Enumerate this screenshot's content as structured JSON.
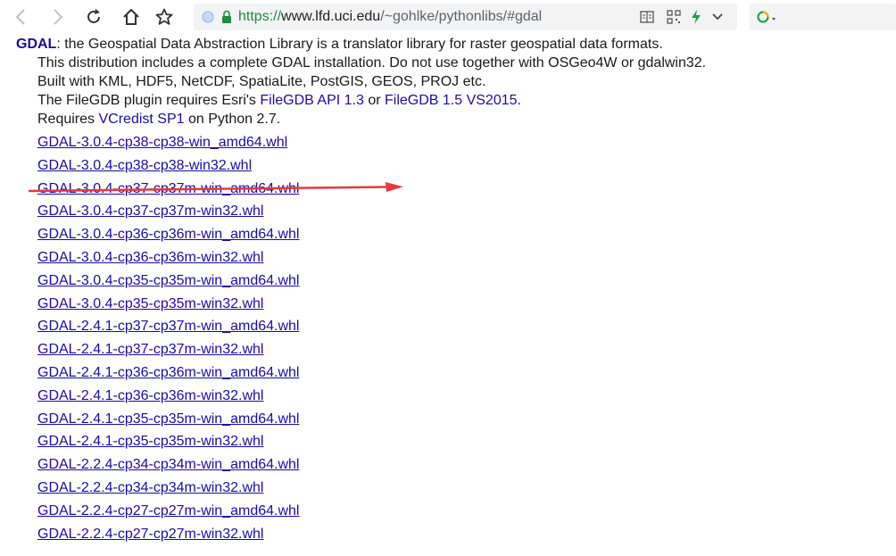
{
  "browser": {
    "url_scheme": "https://",
    "url_host": "www.lfd.uci.edu",
    "url_path": "/~gohlke/pythonlibs/#gdal",
    "accent_secure": "#1e8e3e",
    "icons": [
      "back-icon",
      "forward-icon",
      "reload-icon",
      "home-icon",
      "star-icon",
      "globe-icon",
      "lock-icon",
      "reader-mode-icon",
      "qr-code-icon",
      "bolt-icon",
      "chevron-down-icon",
      "search-engine-icon"
    ]
  },
  "page": {
    "title_name": "GDAL",
    "title_rest": ": the Geospatial Data Abstraction Library is a translator library for raster geospatial data formats.",
    "line2": "This distribution includes a complete GDAL installation. Do not use together with OSGeo4W or gdalwin32.",
    "line3": "Built with KML, HDF5, NetCDF, SpatiaLite, PostGIS, GEOS, PROJ etc.",
    "line4_pre": "The FileGDB plugin requires Esri's ",
    "line4_link1": "FileGDB API 1.3",
    "line4_mid": " or ",
    "line4_link2": "FileGDB 1.5 VS2015",
    "line4_post": ".",
    "line5_pre": "Requires ",
    "line5_link": "VCredist SP1",
    "line5_post": " on Python 2.7.",
    "wheels": [
      "GDAL-3.0.4-cp38-cp38-win_amd64.whl",
      "GDAL-3.0.4-cp38-cp38-win32.whl",
      "GDAL-3.0.4-cp37-cp37m-win_amd64.whl",
      "GDAL-3.0.4-cp37-cp37m-win32.whl",
      "GDAL-3.0.4-cp36-cp36m-win_amd64.whl",
      "GDAL-3.0.4-cp36-cp36m-win32.whl",
      "GDAL-3.0.4-cp35-cp35m-win_amd64.whl",
      "GDAL-3.0.4-cp35-cp35m-win32.whl",
      "GDAL-2.4.1-cp37-cp37m-win_amd64.whl",
      "GDAL-2.4.1-cp37-cp37m-win32.whl",
      "GDAL-2.4.1-cp36-cp36m-win_amd64.whl",
      "GDAL-2.4.1-cp36-cp36m-win32.whl",
      "GDAL-2.4.1-cp35-cp35m-win_amd64.whl",
      "GDAL-2.4.1-cp35-cp35m-win32.whl",
      "GDAL-2.2.4-cp34-cp34m-win_amd64.whl",
      "GDAL-2.2.4-cp34-cp34m-win32.whl",
      "GDAL-2.2.4-cp27-cp27m-win_amd64.whl",
      "GDAL-2.2.4-cp27-cp27m-win32.whl"
    ],
    "annotation_color": "#e8393a"
  }
}
